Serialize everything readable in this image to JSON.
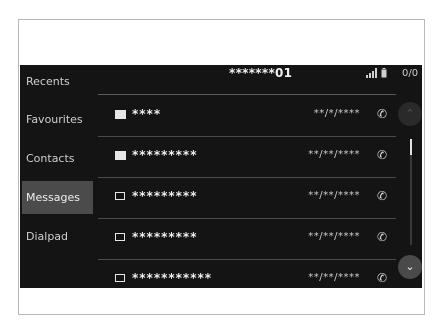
{
  "header": {
    "title": "*******01",
    "signal_icon": "signal-bars-icon",
    "battery_icon": "battery-icon",
    "status_right": "0/0"
  },
  "sidebar": {
    "items": [
      {
        "label": "Recents",
        "active": false
      },
      {
        "label": "Favourites",
        "active": false
      },
      {
        "label": "Contacts",
        "active": false
      },
      {
        "label": "Messages",
        "active": true
      },
      {
        "label": "Dialpad",
        "active": false
      }
    ]
  },
  "messages": [
    {
      "name": "****",
      "date": "**/*/****",
      "icon": "unread-message-icon"
    },
    {
      "name": "*********",
      "date": "**/**/****",
      "icon": "unread-message-icon"
    },
    {
      "name": "*********",
      "date": "**/**/****",
      "icon": "read-message-icon"
    },
    {
      "name": "*********",
      "date": "**/**/****",
      "icon": "read-message-icon"
    },
    {
      "name": "***********",
      "date": "**/**/****",
      "icon": "read-message-icon"
    }
  ],
  "call_icon": "phone-icon",
  "scroll": {
    "up_icon": "chevron-up-icon",
    "down_icon": "chevron-down-icon"
  }
}
